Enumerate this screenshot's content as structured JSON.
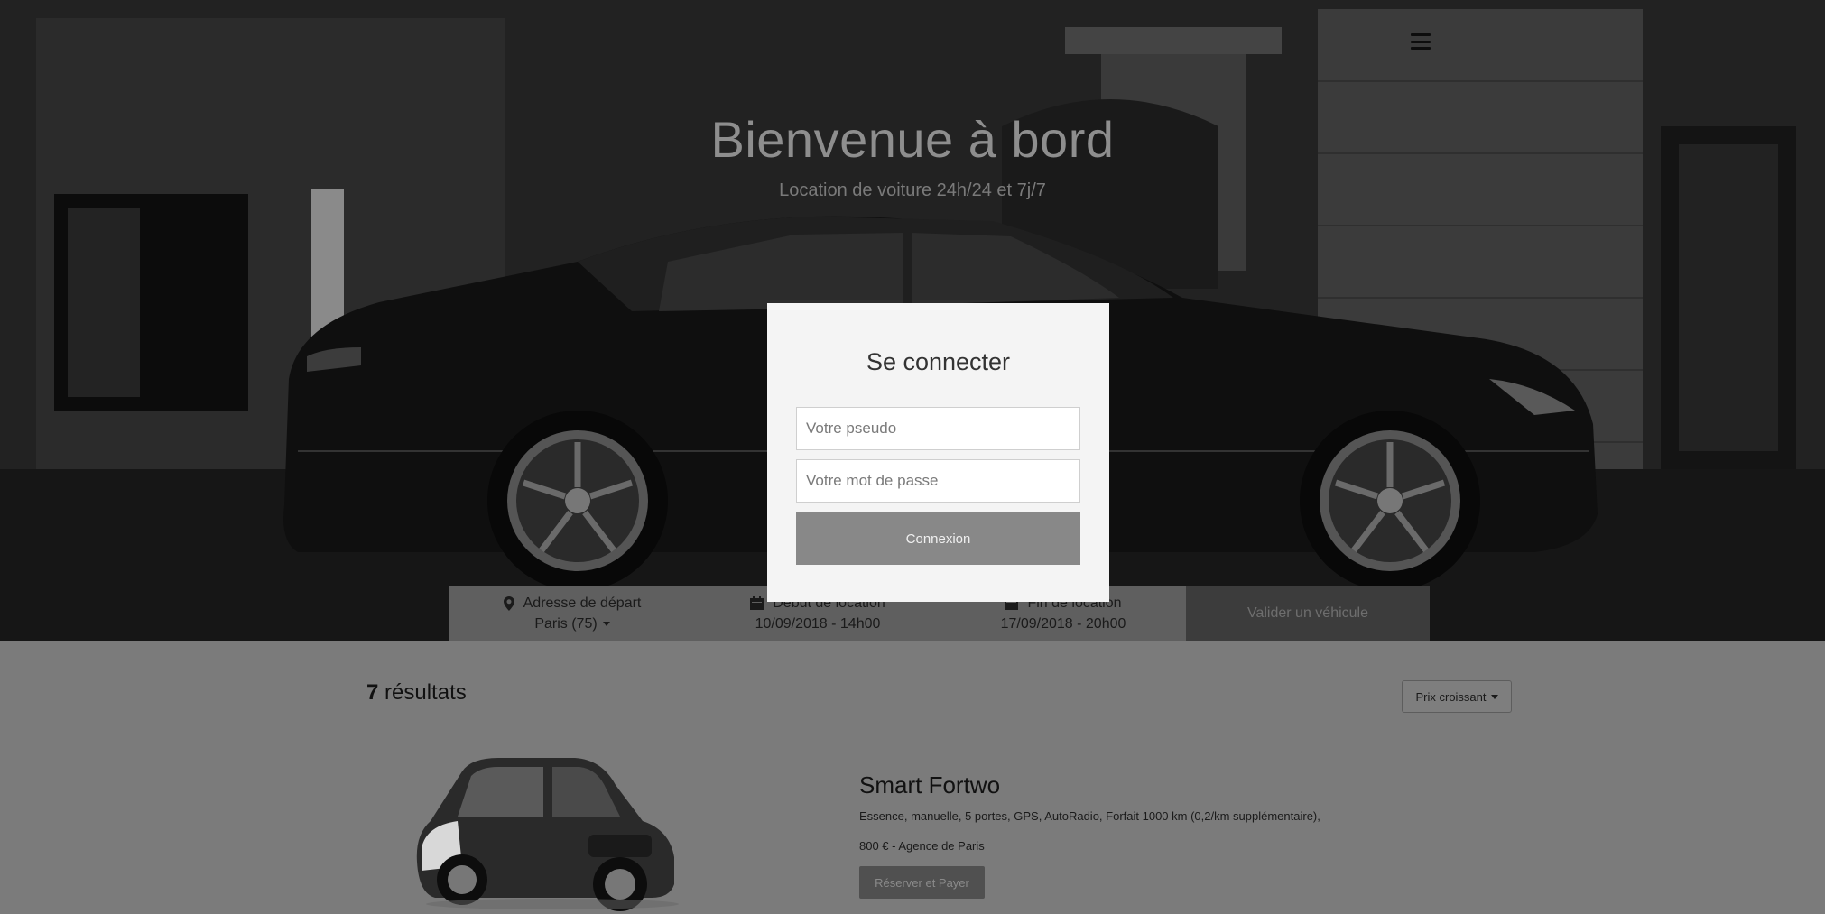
{
  "hero": {
    "title": "Bienvenue à bord",
    "subtitle": "Location de voiture 24h/24 et 7j/7"
  },
  "search": {
    "departure_label": "Adresse de départ",
    "departure_value": "Paris (75)",
    "start_label": "Début de location",
    "start_value": "10/09/2018 - 14h00",
    "end_label": "Fin de location",
    "end_value": "17/09/2018 - 20h00",
    "validate_label": "Valider un véhicule"
  },
  "results": {
    "count": "7",
    "count_label": " résultats",
    "sort_label": "Prix croissant",
    "car": {
      "name": "Smart Fortwo",
      "description": "Essence, manuelle, 5 portes, GPS, AutoRadio, Forfait 1000 km (0,2/km supplémentaire),",
      "price_agency": "800 € - Agence de Paris",
      "reserve_label": "Réserver et Payer"
    }
  },
  "login": {
    "title": "Se connecter",
    "username_placeholder": "Votre pseudo",
    "password_placeholder": "Votre mot de passe",
    "submit_label": "Connexion"
  },
  "icons": {
    "menu": "hamburger-menu-icon",
    "location": "map-marker-icon",
    "calendar": "calendar-icon",
    "caret": "caret-down-icon"
  },
  "colors": {
    "modal_bg": "#f4f4f4",
    "login_button": "#888888",
    "search_bar": "#5f5f5f",
    "results_bg": "#7b7b7b"
  }
}
